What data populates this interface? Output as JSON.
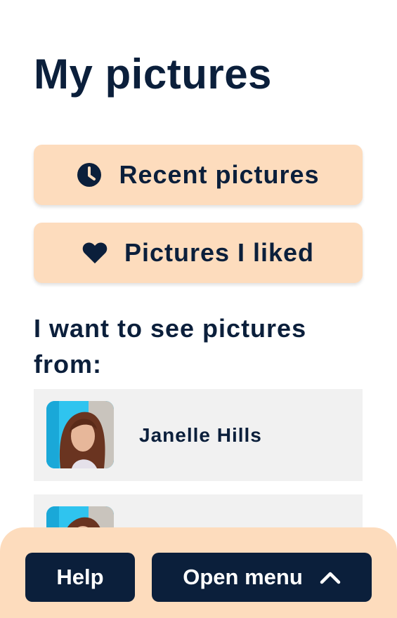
{
  "page": {
    "title": "My pictures"
  },
  "actions": {
    "recent": {
      "label": "Recent pictures",
      "icon": "clock-icon"
    },
    "liked": {
      "label": "Pictures I liked",
      "icon": "heart-icon"
    }
  },
  "sources": {
    "heading": "I want to see pictures from:",
    "items": [
      {
        "name": "Janelle Hills"
      },
      {
        "name": ""
      }
    ]
  },
  "footer": {
    "help_label": "Help",
    "menu_label": "Open menu",
    "menu_icon": "chevron-up-icon"
  },
  "colors": {
    "accent_bg": "#fddcbd",
    "dark": "#0b1f3b",
    "item_bg": "#f1f1f1",
    "avatar_bg": "#2fc4ef"
  }
}
